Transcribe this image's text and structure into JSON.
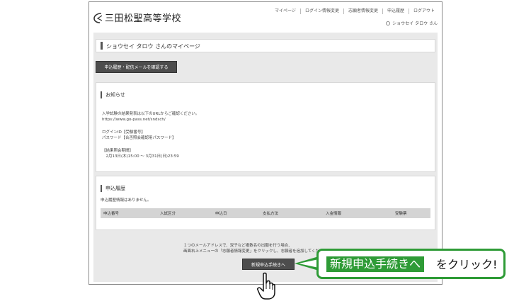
{
  "header": {
    "school_name": "三田松聖高等学校",
    "nav": [
      {
        "label": "マイページ"
      },
      {
        "label": "ログイン情報変更"
      },
      {
        "label": "志願者情報変更"
      },
      {
        "label": "申込履歴"
      },
      {
        "label": "ログアウト"
      }
    ],
    "user_name": "ショウセイ タロウ さん"
  },
  "page_title": "ショウセイ タロウ さんのマイページ",
  "history_mail_button": "申込履歴・配信メールを確認する",
  "notice": {
    "heading": "お知らせ",
    "lines": [
      "入学試験の結果発表は以下のURLからご確認ください。",
      "https://www.go-pass.net/sndsch/",
      "ログインID【受験番号】",
      "パスワード【合否照会確認用パスワード】",
      "【結果照会期間】",
      "　2月13日(木)15:00 ～ 3月31日(日)23:59"
    ]
  },
  "history": {
    "heading": "申込履歴",
    "empty_text": "申込履歴情報はありません。",
    "columns": [
      "申込番号",
      "入試区分",
      "申込日",
      "支払方法",
      "入金情報",
      "受験票"
    ]
  },
  "footer_lines": [
    "１つのメールアドレスで、双子など複数名の出願を行う場合、",
    "画面右上メニューの「志願者情報変更」をクリックし、志願者を追加してください。"
  ],
  "new_application_button": "新規申込手続きへ",
  "callout": {
    "highlight": "新規申込手続きへ",
    "rest": "をクリック!"
  },
  "colors": {
    "callout_green": "#2e9b36",
    "button_dark": "#4d4d4d",
    "content_bg": "#e9e9e9"
  }
}
